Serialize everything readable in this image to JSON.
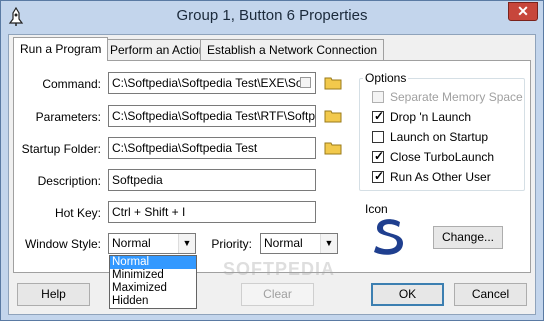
{
  "window": {
    "title": "Group 1, Button 6 Properties",
    "close_glyph": "✕"
  },
  "tabs": [
    {
      "label": "Run a Program",
      "active": true
    },
    {
      "label": "Perform an Action",
      "active": false
    },
    {
      "label": "Establish a Network Connection",
      "active": false
    }
  ],
  "form": {
    "command_label": "Command:",
    "command_value": "C:\\Softpedia\\Softpedia Test\\EXE\\Sof",
    "parameters_label": "Parameters:",
    "parameters_value": "C:\\Softpedia\\Softpedia Test\\RTF\\Softpedi",
    "startup_label": "Startup Folder:",
    "startup_value": "C:\\Softpedia\\Softpedia Test",
    "description_label": "Description:",
    "description_value": "Softpedia",
    "hotkey_label": "Hot Key:",
    "hotkey_value": "Ctrl + Shift + I",
    "window_style_label": "Window Style:",
    "window_style_value": "Normal",
    "window_style_options": [
      "Normal",
      "Minimized",
      "Maximized",
      "Hidden"
    ],
    "priority_label": "Priority:",
    "priority_value": "Normal"
  },
  "options": {
    "title": "Options",
    "items": [
      {
        "label": "Separate Memory Space",
        "checked": false,
        "disabled": true
      },
      {
        "label": "Drop 'n Launch",
        "checked": true,
        "disabled": false
      },
      {
        "label": "Launch on Startup",
        "checked": false,
        "disabled": false
      },
      {
        "label": "Close TurboLaunch",
        "checked": true,
        "disabled": false
      },
      {
        "label": "Run As Other User",
        "checked": true,
        "disabled": false
      }
    ]
  },
  "icon_group": {
    "title": "Icon",
    "change_button": "Change..."
  },
  "buttons": {
    "help": "Help",
    "clear": "Clear",
    "ok": "OK",
    "cancel": "Cancel"
  },
  "watermark": "SOFTPEDIA",
  "colors": {
    "selection": "#3399ff",
    "icon_blue": "#1f3f8f",
    "folder_yellow": "#f2c94c"
  }
}
